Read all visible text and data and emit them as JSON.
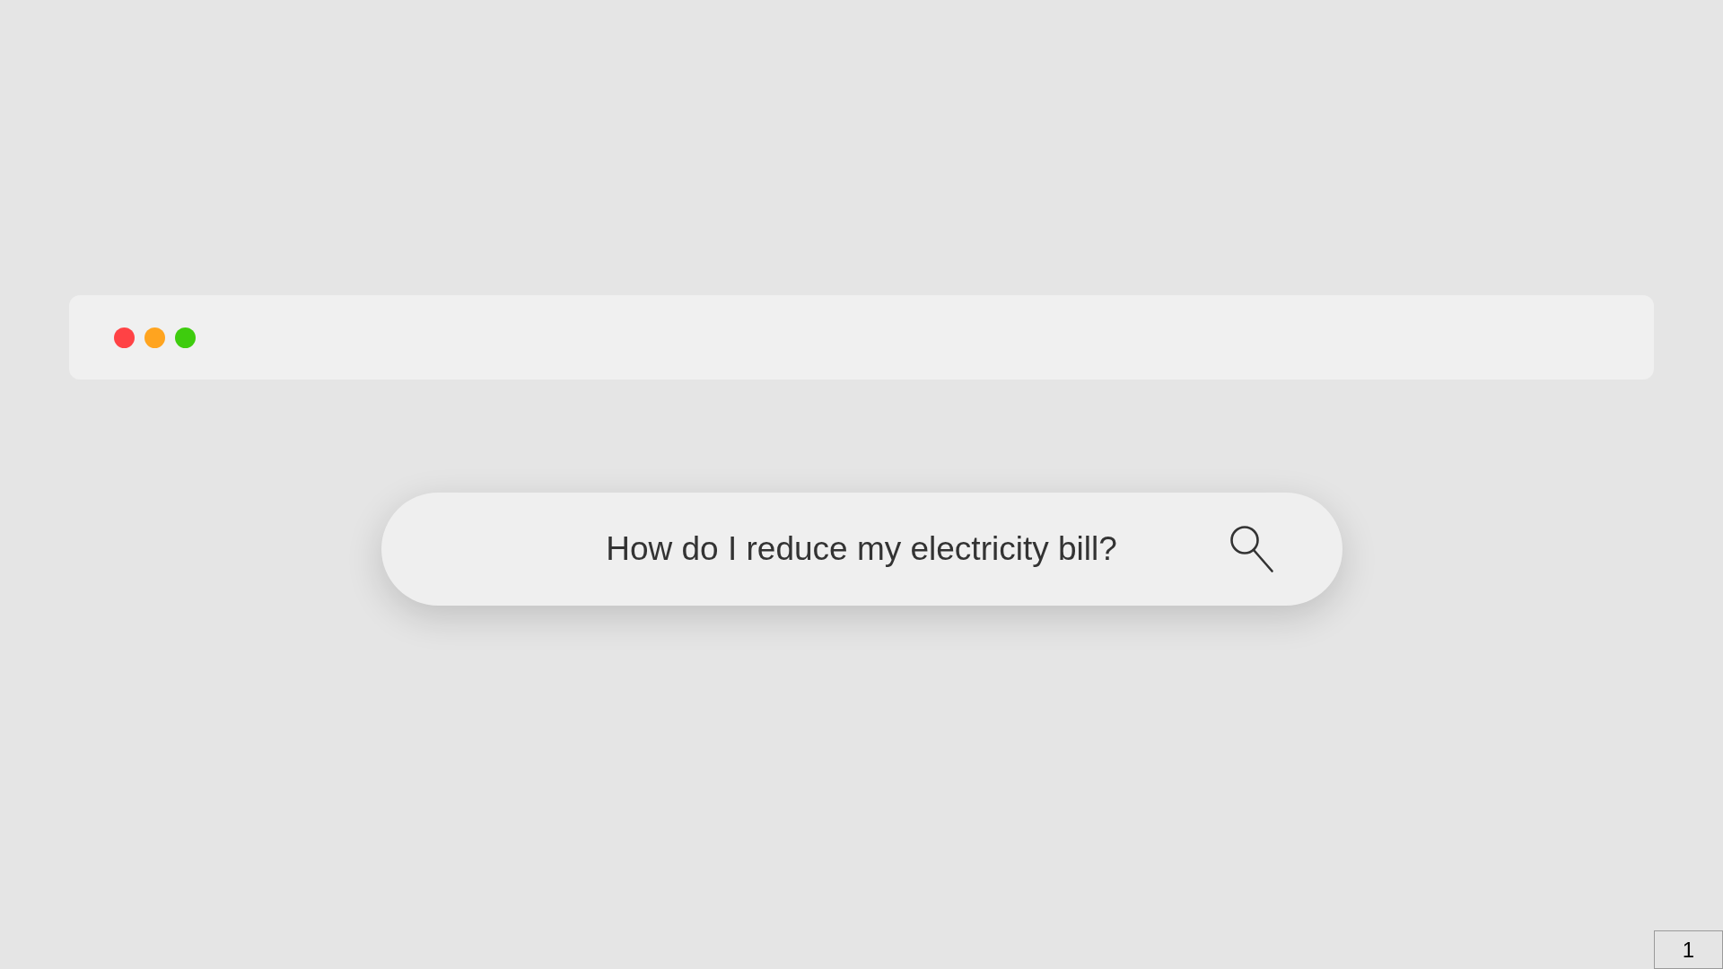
{
  "window": {
    "controls": [
      {
        "color": "#ff4245"
      },
      {
        "color": "#ffa41f"
      },
      {
        "color": "#3ecc0e"
      }
    ]
  },
  "search": {
    "value": "How do I reduce my electricity bill?"
  },
  "page_number": "1"
}
